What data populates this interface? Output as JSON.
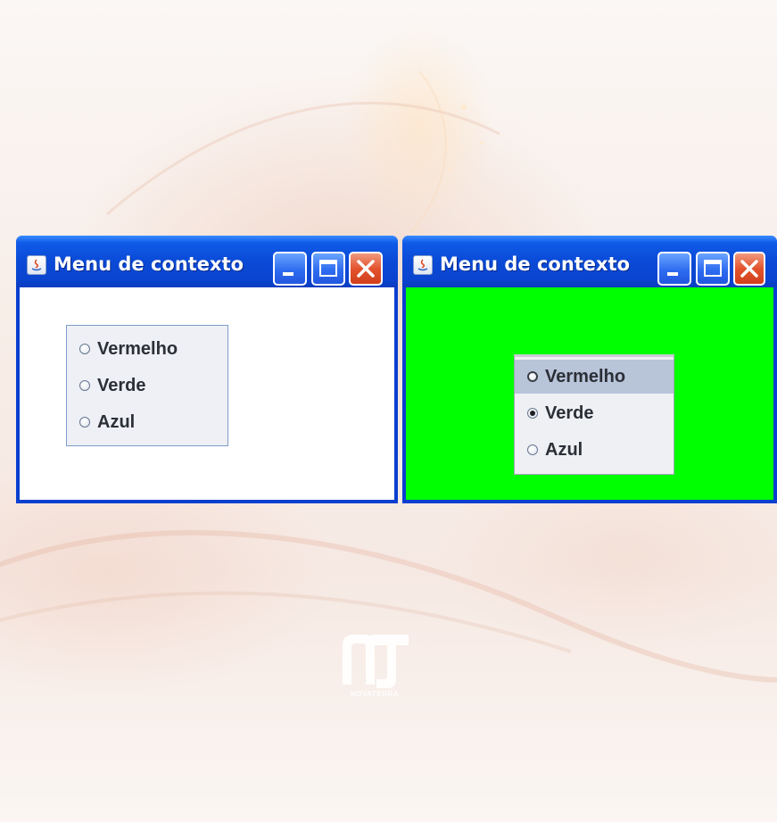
{
  "windows": [
    {
      "title": "Menu de contexto",
      "background_color": "#ffffff",
      "radio_options": [
        {
          "label": "Vermelho",
          "checked": false
        },
        {
          "label": "Verde",
          "checked": false
        },
        {
          "label": "Azul",
          "checked": false
        }
      ]
    },
    {
      "title": "Menu de contexto",
      "background_color": "#00ff00",
      "popup_options": [
        {
          "label": "Vermelho",
          "checked": false,
          "highlighted": true
        },
        {
          "label": "Verde",
          "checked": true,
          "highlighted": false
        },
        {
          "label": "Azul",
          "checked": false,
          "highlighted": false
        }
      ]
    }
  ],
  "titlebar_buttons": [
    "minimize-icon",
    "maximize-icon",
    "close-icon"
  ],
  "watermark": {
    "text": "NOVATERRA"
  },
  "colors": {
    "titlebar": "#0a4ad6",
    "close_button": "#e3532e",
    "window_frame": "#0a3fd0"
  }
}
